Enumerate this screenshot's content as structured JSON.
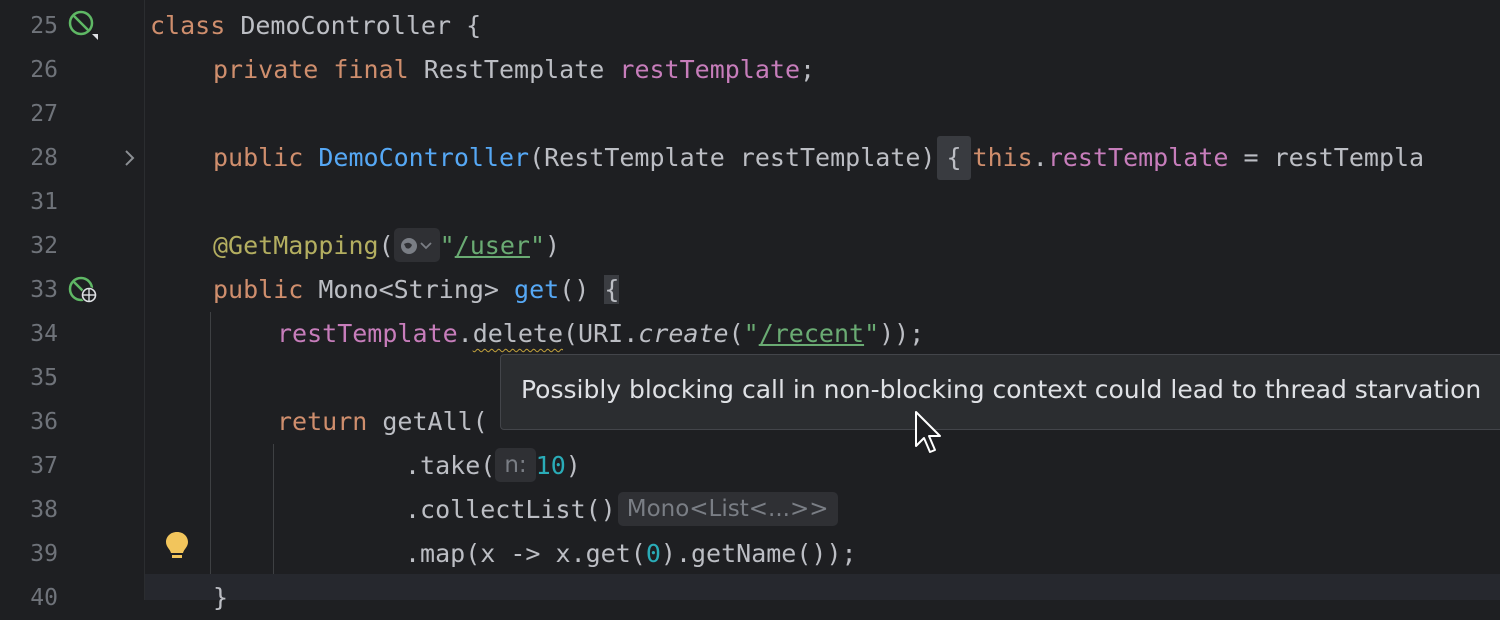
{
  "editor": {
    "lines": [
      {
        "number": "25",
        "code": "class DemoController {"
      },
      {
        "number": "26",
        "code": "private final RestTemplate restTemplate;"
      },
      {
        "number": "27",
        "code": ""
      },
      {
        "number": "28",
        "code": "public DemoController(RestTemplate restTemplate) { this.restTemplate = restTempla"
      },
      {
        "number": "31",
        "code": ""
      },
      {
        "number": "32",
        "code": "@GetMapping(\"/user\")"
      },
      {
        "number": "33",
        "code": "public Mono<String> get() {"
      },
      {
        "number": "34",
        "code": "restTemplate.delete(URI.create(\"/recent\"));"
      },
      {
        "number": "35",
        "code": ""
      },
      {
        "number": "36",
        "code": "return getAll()"
      },
      {
        "number": "37",
        "code": ".take(10)"
      },
      {
        "number": "38",
        "code": ".collectList()"
      },
      {
        "number": "39",
        "code": ".map(x -> x.get(0).getName());"
      },
      {
        "number": "40",
        "code": "}"
      }
    ],
    "tokens": {
      "l25": {
        "kw": "class ",
        "name": "DemoController {"
      },
      "l26": {
        "kw": "private final ",
        "type": "RestTemplate ",
        "field": "restTemplate",
        "end": ";"
      },
      "l28": {
        "kw": "public ",
        "fn": "DemoController",
        "params": "(RestTemplate restTemplate)",
        "brace": "{",
        "this": "this",
        "dot": ".",
        "field": "restTemplate",
        "rest": " = restTempla"
      },
      "l32": {
        "ann": "@GetMapping",
        "open": "(",
        "q1": "\"",
        "path": "/user",
        "q2": "\"",
        "close": ")"
      },
      "l33": {
        "kw": "public ",
        "type": "Mono<String> ",
        "fn": "get",
        "parens": "() ",
        "brace": "{"
      },
      "l34": {
        "field": "restTemplate",
        "dot": ".",
        "method": "delete",
        "mid": "(URI.",
        "create": "create",
        "open": "(",
        "q1": "\"",
        "path": "/recent",
        "q2": "\"",
        "end": "));"
      },
      "l36": {
        "kw": "return ",
        "call": "getAll("
      },
      "l37": {
        "call": ".take(",
        "param_hint": "n:",
        "num": "10",
        "end": ")"
      },
      "l38": {
        "call": ".collectList()",
        "type_hint": "Mono<List<...>>"
      },
      "l39": {
        "a": ".map(x -> x.get(",
        "num": "0",
        "b": ").getName());"
      },
      "l40": {
        "brace": "}"
      }
    },
    "tooltip": "Possibly blocking call in non-blocking context could lead to thread starvation",
    "icons": [
      "spring-bean-icon",
      "folded-code-chevron-icon",
      "web-endpoint-icon",
      "web-request-globe-icon",
      "intention-bulb-icon",
      "mouse-cursor-icon"
    ],
    "colors": {
      "background": "#1e1f22",
      "keyword": "#cf8e6d",
      "field": "#c77dbb",
      "function": "#56a8f5",
      "annotation": "#b3ae60",
      "string": "#6aab73",
      "number": "#2aacb8",
      "text": "#bcbec4",
      "line_number": "#6f737a",
      "tooltip_bg": "#2b2d30"
    }
  }
}
